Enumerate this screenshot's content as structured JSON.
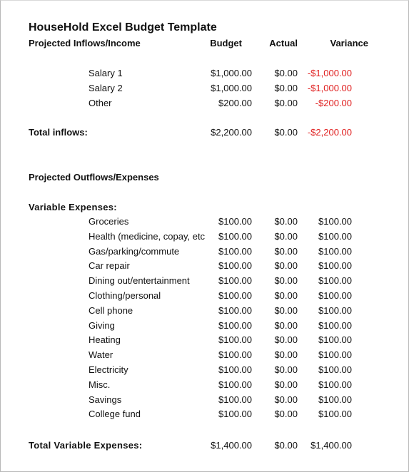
{
  "title": "HouseHold Excel Budget Template",
  "headers": {
    "section": "Projected Inflows/Income",
    "budget": "Budget",
    "actual": "Actual",
    "variance": "Variance"
  },
  "colors": {
    "negative": "#e02020",
    "text": "#111111"
  },
  "inflows": [
    {
      "label": "Salary 1",
      "budget": "$1,000.00",
      "actual": "$0.00",
      "variance": "-$1,000.00"
    },
    {
      "label": "Salary 2",
      "budget": "$1,000.00",
      "actual": "$0.00",
      "variance": "-$1,000.00"
    },
    {
      "label": "Other",
      "budget": "$200.00",
      "actual": "$0.00",
      "variance": "-$200.00"
    }
  ],
  "total_inflows": {
    "label": "Total inflows:",
    "budget": "$2,200.00",
    "actual": "$0.00",
    "variance": "-$2,200.00"
  },
  "outflows_heading": "Projected Outflows/Expenses",
  "variable_heading": "Variable Expenses:",
  "variable_expenses": [
    {
      "label": "Groceries",
      "budget": "$100.00",
      "actual": "$0.00",
      "variance": "$100.00"
    },
    {
      "label": "Health (medicine, copay, etc",
      "budget": "$100.00",
      "actual": "$0.00",
      "variance": "$100.00"
    },
    {
      "label": "Gas/parking/commute",
      "budget": "$100.00",
      "actual": "$0.00",
      "variance": "$100.00"
    },
    {
      "label": "Car repair",
      "budget": "$100.00",
      "actual": "$0.00",
      "variance": "$100.00"
    },
    {
      "label": "Dining out/entertainment",
      "budget": "$100.00",
      "actual": "$0.00",
      "variance": "$100.00"
    },
    {
      "label": "Clothing/personal",
      "budget": "$100.00",
      "actual": "$0.00",
      "variance": "$100.00"
    },
    {
      "label": "Cell phone",
      "budget": "$100.00",
      "actual": "$0.00",
      "variance": "$100.00"
    },
    {
      "label": "Giving",
      "budget": "$100.00",
      "actual": "$0.00",
      "variance": "$100.00"
    },
    {
      "label": "Heating",
      "budget": "$100.00",
      "actual": "$0.00",
      "variance": "$100.00"
    },
    {
      "label": "Water",
      "budget": "$100.00",
      "actual": "$0.00",
      "variance": "$100.00"
    },
    {
      "label": "Electricity",
      "budget": "$100.00",
      "actual": "$0.00",
      "variance": "$100.00"
    },
    {
      "label": "Misc.",
      "budget": "$100.00",
      "actual": "$0.00",
      "variance": "$100.00"
    },
    {
      "label": "Savings",
      "budget": "$100.00",
      "actual": "$0.00",
      "variance": "$100.00"
    },
    {
      "label": "College fund",
      "budget": "$100.00",
      "actual": "$0.00",
      "variance": "$100.00"
    }
  ],
  "total_variable": {
    "label": "Total Variable Expenses:",
    "budget": "$1,400.00",
    "actual": "$0.00",
    "variance": "$1,400.00"
  }
}
